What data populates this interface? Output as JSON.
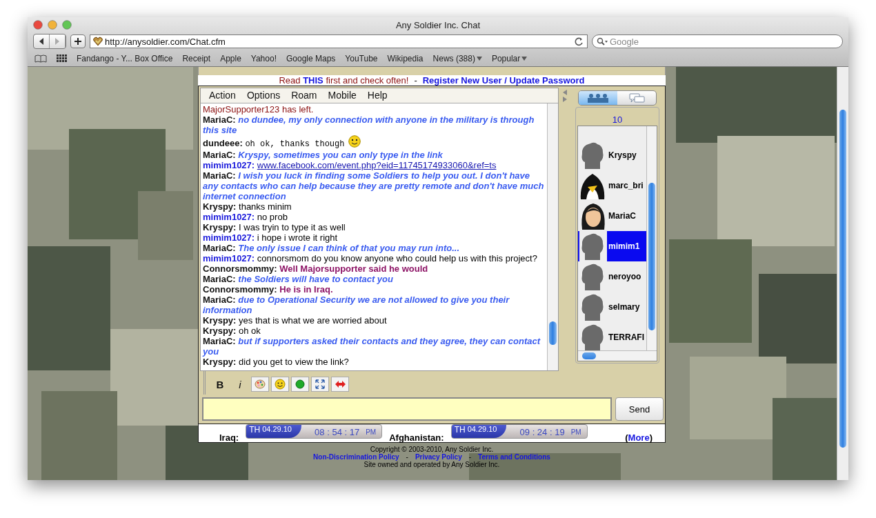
{
  "window": {
    "title": "Any Soldier Inc. Chat"
  },
  "toolbar": {
    "url": "http://anysoldier.com/Chat.cfm",
    "search_placeholder": "Google"
  },
  "bookmarks": [
    {
      "label": "Fandango - Y... Box Office",
      "menu": false
    },
    {
      "label": "Receipt",
      "menu": false
    },
    {
      "label": "Apple",
      "menu": false
    },
    {
      "label": "Yahoo!",
      "menu": false
    },
    {
      "label": "Google Maps",
      "menu": false
    },
    {
      "label": "YouTube",
      "menu": false
    },
    {
      "label": "Wikipedia",
      "menu": false
    },
    {
      "label": "News (388)",
      "menu": true
    },
    {
      "label": "Popular",
      "menu": true
    }
  ],
  "notice": {
    "before": "Read ",
    "link": "THIS",
    "after": " first and check often!",
    "separator": "-",
    "register_link": "Register New User / Update Password"
  },
  "menu": [
    "Action",
    "Options",
    "Roam",
    "Mobile",
    "Help"
  ],
  "messages": [
    {
      "kind": "system",
      "text": "MajorSupporter123 has left.",
      "smiley": false
    },
    {
      "kind": "italic",
      "user": "MariaC:",
      "color": "#111111",
      "text": "no dundee, my only connection with anyone in the military is through this site",
      "smiley": false
    },
    {
      "kind": "mono",
      "user": "dundeee:",
      "color": "#111111",
      "text": "oh ok, thanks though",
      "smiley": true
    },
    {
      "kind": "italic",
      "user": "MariaC:",
      "color": "#111111",
      "text": "Kryspy, sometimes you can only type in the link",
      "smiley": false
    },
    {
      "kind": "link",
      "user": "mimim1027:",
      "color": "#1a1adc",
      "text": "www.facebook.com/event.php?eid=11745174933060&ref=ts",
      "smiley": false
    },
    {
      "kind": "italic",
      "user": "MariaC:",
      "color": "#111111",
      "text": "I wish you luck in finding some Soldiers to help you out.  I don't have any contacts who can help because they are pretty remote and don't have much internet connection",
      "smiley": false
    },
    {
      "kind": "plain",
      "user": "Kryspy:",
      "color": "#111111",
      "text": "thanks minim",
      "smiley": false
    },
    {
      "kind": "plain",
      "user": "mimim1027:",
      "color": "#1a1adc",
      "text": "no prob",
      "smiley": false
    },
    {
      "kind": "plain",
      "user": "Kryspy:",
      "color": "#111111",
      "text": "I was tryin to type it as well",
      "smiley": false
    },
    {
      "kind": "plain",
      "user": "mimim1027:",
      "color": "#1a1adc",
      "text": "i hope i wrote it right",
      "smiley": false
    },
    {
      "kind": "italic",
      "user": "MariaC:",
      "color": "#111111",
      "text": "The only issue I can think of that you may run into...",
      "smiley": false
    },
    {
      "kind": "plain",
      "user": "mimim1027:",
      "color": "#1a1adc",
      "text": "connorsmom do you know anyone who could help us with this project?",
      "smiley": false
    },
    {
      "kind": "bold",
      "user": "Connorsmommy:",
      "color": "#111111",
      "text": "Well Majorsupporter said he would",
      "smiley": false
    },
    {
      "kind": "italic",
      "user": "MariaC:",
      "color": "#111111",
      "text": "the Soldiers will have to contact you",
      "smiley": false
    },
    {
      "kind": "bold",
      "user": "Connorsmommy:",
      "color": "#111111",
      "text": "He is in Iraq.",
      "smiley": false
    },
    {
      "kind": "italic",
      "user": "MariaC:",
      "color": "#111111",
      "text": "due to Operational Security we are not allowed to give you their information",
      "smiley": false
    },
    {
      "kind": "plain",
      "user": "Kryspy:",
      "color": "#111111",
      "text": "yes that is what we are worried about",
      "smiley": false
    },
    {
      "kind": "plain",
      "user": "Kryspy:",
      "color": "#111111",
      "text": "oh ok",
      "smiley": false
    },
    {
      "kind": "italic",
      "user": "MariaC:",
      "color": "#111111",
      "text": "but if supporters asked their contacts and they agree, they can contact you",
      "smiley": false
    },
    {
      "kind": "plain",
      "user": "Kryspy:",
      "color": "#111111",
      "text": "did you get to view the link?",
      "smiley": false
    }
  ],
  "user_count": "10",
  "users": [
    {
      "name": "Kryspy",
      "kind": "silhouette",
      "selected": false
    },
    {
      "name": "marc_bri",
      "kind": "penguin",
      "selected": false
    },
    {
      "name": "MariaC",
      "kind": "portrait",
      "selected": false
    },
    {
      "name": "mimim1",
      "kind": "silhouette",
      "selected": true
    },
    {
      "name": "neroyoo",
      "kind": "silhouette",
      "selected": false
    },
    {
      "name": "selmary",
      "kind": "silhouette",
      "selected": false
    },
    {
      "name": "TERRAFI",
      "kind": "silhouette",
      "selected": false
    }
  ],
  "format_bar": {
    "bold": "B",
    "italic": "i"
  },
  "send": "Send",
  "clocks": [
    {
      "label": "Iraq:",
      "day": "TH",
      "date": "04.29.10",
      "time": "08 : 54 : 17",
      "ampm": "PM"
    },
    {
      "label": "Afghanistan:",
      "day": "TH",
      "date": "04.29.10",
      "time": "09 : 24 : 19",
      "ampm": "PM"
    }
  ],
  "more": {
    "open": "(",
    "link": "More",
    "close": ")"
  },
  "footer": {
    "copyright": "Copyright © 2003-2010, Any Soldier Inc.",
    "links": [
      "Non-Discrimination Policy",
      "Privacy Policy",
      "Terms and Conditions"
    ],
    "separator": "-",
    "owned": "Site owned and operated by Any Soldier Inc."
  }
}
